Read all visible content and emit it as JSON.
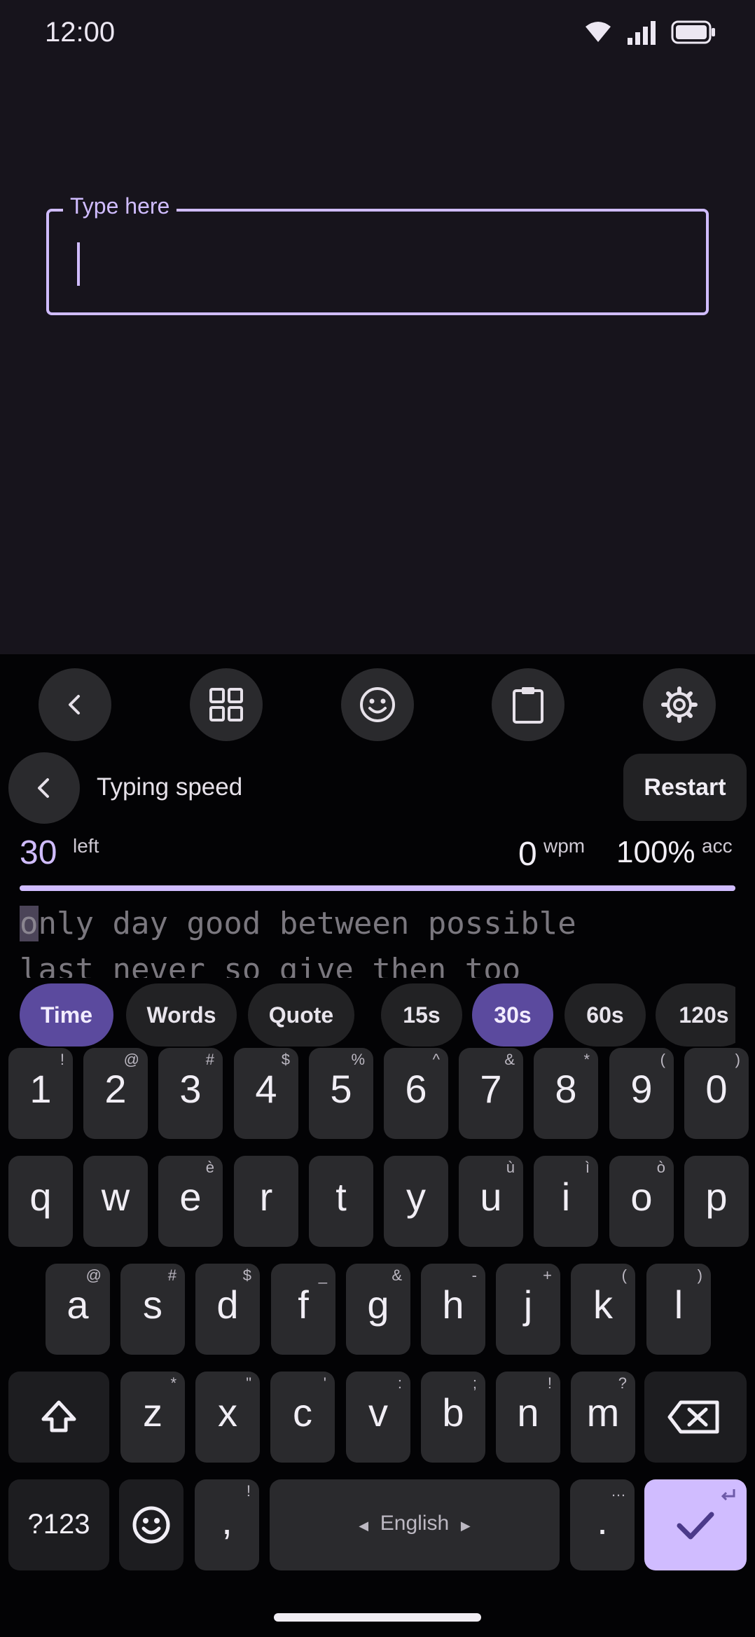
{
  "status_bar": {
    "time": "12:00"
  },
  "input": {
    "label": "Type here",
    "value": ""
  },
  "toolbar": {
    "icons": [
      "chevron-left-icon",
      "grid-icon",
      "emoji-icon",
      "clipboard-icon",
      "gear-icon"
    ]
  },
  "typing_speed": {
    "title": "Typing speed",
    "restart_label": "Restart",
    "time_left": "30",
    "time_left_unit": "left",
    "wpm": "0",
    "wpm_unit": "wpm",
    "accuracy": "100%",
    "accuracy_unit": "acc",
    "progress_fraction": 1.0,
    "cursor_char": "o",
    "line1_rest": "nly day good between possible",
    "line2": "last never so give then too"
  },
  "mode_chips": [
    {
      "label": "Time",
      "active": true
    },
    {
      "label": "Words",
      "active": false
    },
    {
      "label": "Quote",
      "active": false
    }
  ],
  "duration_chips": [
    {
      "label": "15s",
      "active": false
    },
    {
      "label": "30s",
      "active": true
    },
    {
      "label": "60s",
      "active": false
    },
    {
      "label": "120s",
      "active": false
    }
  ],
  "keyboard": {
    "number_row": [
      {
        "main": "1",
        "sub": "!"
      },
      {
        "main": "2",
        "sub": "@"
      },
      {
        "main": "3",
        "sub": "#"
      },
      {
        "main": "4",
        "sub": "$"
      },
      {
        "main": "5",
        "sub": "%"
      },
      {
        "main": "6",
        "sub": "^"
      },
      {
        "main": "7",
        "sub": "&"
      },
      {
        "main": "8",
        "sub": "*"
      },
      {
        "main": "9",
        "sub": "("
      },
      {
        "main": "0",
        "sub": ")"
      }
    ],
    "row1": [
      {
        "main": "q",
        "sub": ""
      },
      {
        "main": "w",
        "sub": ""
      },
      {
        "main": "e",
        "sub": "è"
      },
      {
        "main": "r",
        "sub": ""
      },
      {
        "main": "t",
        "sub": ""
      },
      {
        "main": "y",
        "sub": ""
      },
      {
        "main": "u",
        "sub": "ù"
      },
      {
        "main": "i",
        "sub": "ì"
      },
      {
        "main": "o",
        "sub": "ò"
      },
      {
        "main": "p",
        "sub": ""
      }
    ],
    "row2": [
      {
        "main": "a",
        "sub": "@"
      },
      {
        "main": "s",
        "sub": "#"
      },
      {
        "main": "d",
        "sub": "$"
      },
      {
        "main": "f",
        "sub": "_"
      },
      {
        "main": "g",
        "sub": "&"
      },
      {
        "main": "h",
        "sub": "-"
      },
      {
        "main": "j",
        "sub": "+"
      },
      {
        "main": "k",
        "sub": "("
      },
      {
        "main": "l",
        "sub": ")"
      }
    ],
    "row3": [
      {
        "main": "z",
        "sub": "*"
      },
      {
        "main": "x",
        "sub": "\""
      },
      {
        "main": "c",
        "sub": "'"
      },
      {
        "main": "v",
        "sub": ":"
      },
      {
        "main": "b",
        "sub": ";"
      },
      {
        "main": "n",
        "sub": "!"
      },
      {
        "main": "m",
        "sub": "?"
      }
    ],
    "symbols_label": "?123",
    "comma": {
      "main": ",",
      "sub": "!"
    },
    "space_label": "English",
    "period": {
      "main": ".",
      "sub": "…"
    }
  }
}
